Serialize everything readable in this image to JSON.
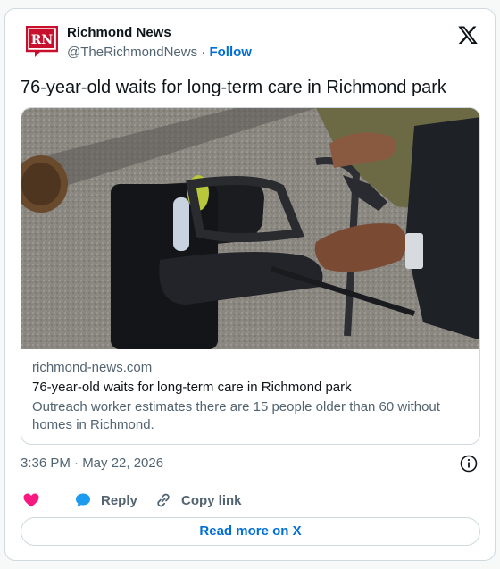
{
  "author": {
    "name": "Richmond News",
    "handle": "@TheRichmondNews",
    "separator": "·",
    "follow_label": "Follow",
    "logo_text": "RN",
    "brand_color": "#c8102e"
  },
  "platform_icon": "x-logo-icon",
  "post": {
    "text": "76-year-old waits for long-term care in Richmond park"
  },
  "link_card": {
    "image_icon": "photo-walker-hands",
    "domain": "richmond-news.com",
    "title": "76-year-old waits for long-term care in Richmond park",
    "description": "Outreach worker estimates there are 15 people older than 60 without homes in Richmond."
  },
  "timestamp": "3:36 PM · May 22, 2026",
  "actions": {
    "like_icon": "heart-icon",
    "reply_label": "Reply",
    "copy_label": "Copy link"
  },
  "read_more_label": "Read more on X",
  "colors": {
    "link_blue": "#006fd6",
    "like_pink": "#f91880",
    "reply_blue": "#1d9bf0",
    "muted": "#536471"
  }
}
